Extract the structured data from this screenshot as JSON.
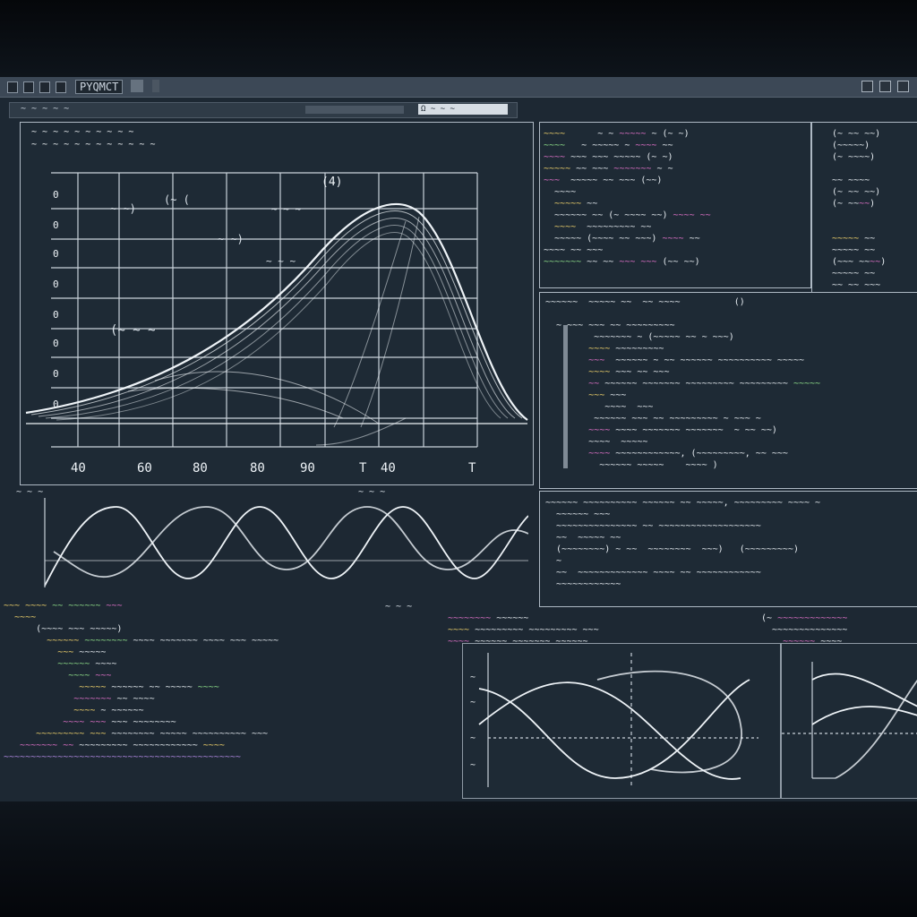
{
  "window": {
    "title": "PYQMCT"
  },
  "toolbar": {
    "path": "~ ~ ~ ~ ~",
    "field": "Ω ~ ~ ~"
  },
  "colors": {
    "background": "#1d2833",
    "curve": "#eef3f7",
    "grid": "#c9d2da",
    "code_magenta": "#e071c8",
    "code_yellow": "#f1d36b",
    "code_green": "#8fe08a"
  },
  "main_plot": {
    "caption": "~ ~ ~ ~ ~ ~ ~ ~ ~ ~",
    "caption2": "~ ~ ~ ~ ~ ~ ~ ~ ~ ~ ~ ~",
    "peak_label": "(4)",
    "x_ticks": [
      "40",
      "60",
      "80",
      "80",
      "90",
      "T",
      "40",
      "T"
    ],
    "y_ticks": [
      "0",
      "0",
      "0",
      "0",
      "0",
      "0",
      "0",
      "0"
    ]
  },
  "wave_plot": {
    "label_left": "~ ~ ~",
    "label_right": "~ ~ ~"
  },
  "bottom_plot": {
    "label": "~ ~ ~"
  }
}
